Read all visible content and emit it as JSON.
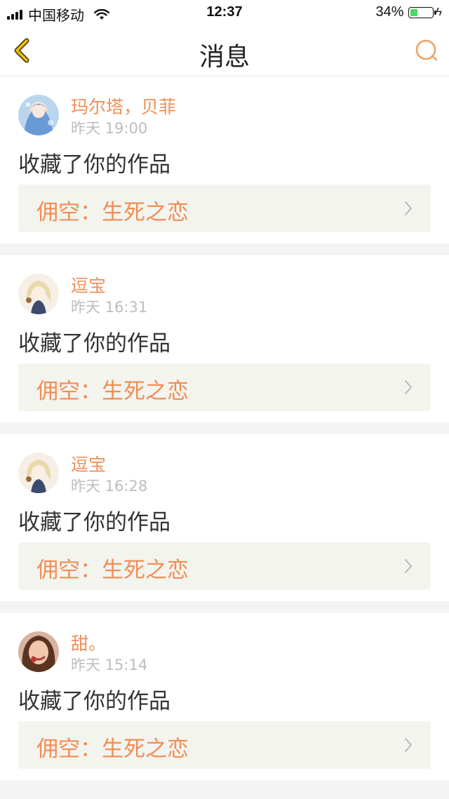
{
  "status_bar": {
    "carrier": "中国移动",
    "time": "12:37",
    "battery_percent": "34%",
    "battery_level": 0.34,
    "battery_fill_color": "#4cd964",
    "icons": [
      "signal-icon",
      "wifi-icon",
      "battery-icon",
      "charging-bolt-icon"
    ]
  },
  "nav": {
    "title": "消息",
    "back_icon": "back-chevron-icon",
    "search_icon": "search-icon",
    "accent_color": "#f0c300"
  },
  "theme": {
    "name_color": "#ef8e56",
    "time_color": "#bdbdbd",
    "card_link_bg": "#f4f4ef"
  },
  "messages": [
    {
      "user": "玛尔塔，贝菲",
      "time": "昨天 19:00",
      "action": "收藏了你的作品",
      "work_title": "佣空：生死之恋",
      "avatar": "avatar-blue-anime"
    },
    {
      "user": "逗宝",
      "time": "昨天 16:31",
      "action": "收藏了你的作品",
      "work_title": "佣空：生死之恋",
      "avatar": "avatar-blonde-anime"
    },
    {
      "user": "逗宝",
      "time": "昨天 16:28",
      "action": "收藏了你的作品",
      "work_title": "佣空：生死之恋",
      "avatar": "avatar-blonde-anime"
    },
    {
      "user": "甜。",
      "time": "昨天 15:14",
      "action": "收藏了你的作品",
      "work_title": "佣空：生死之恋",
      "avatar": "avatar-photo-girl"
    }
  ]
}
